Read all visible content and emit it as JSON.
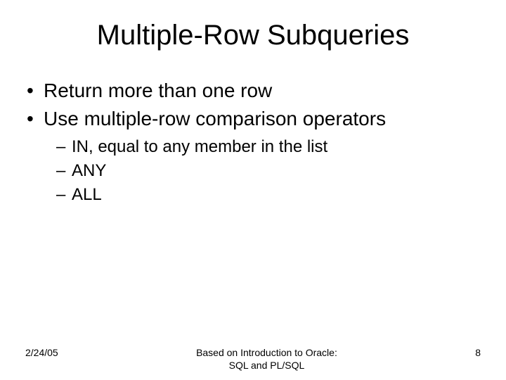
{
  "title": "Multiple-Row Subqueries",
  "bullets": {
    "b1": "Return more than one row",
    "b2": "Use multiple-row comparison operators",
    "sub": {
      "s1": "IN, equal to any member in the list",
      "s2": "ANY",
      "s3": "ALL"
    }
  },
  "footer": {
    "date": "2/24/05",
    "source_line1": "Based on Introduction to Oracle:",
    "source_line2": "SQL and PL/SQL",
    "page": "8"
  }
}
